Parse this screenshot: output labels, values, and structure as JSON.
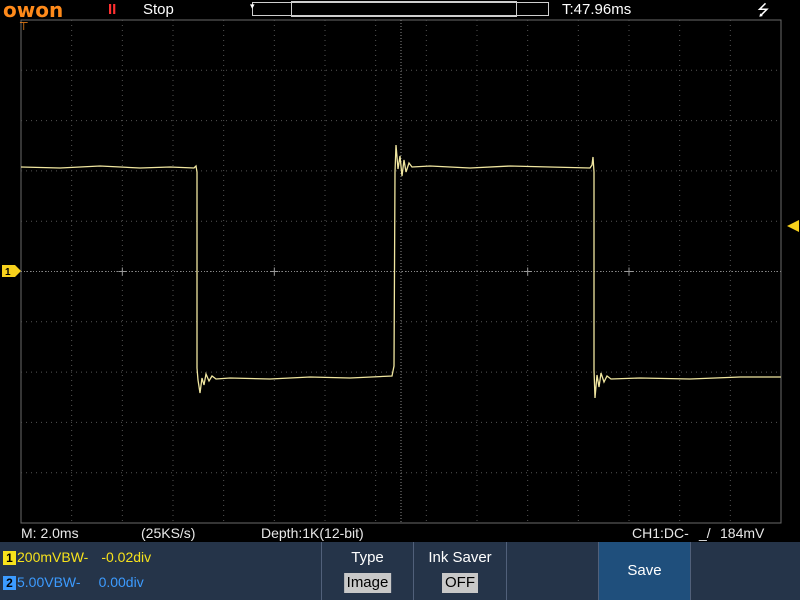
{
  "header": {
    "logo": "owon",
    "run_state_icon": "II",
    "run_state": "Stop",
    "trigger_time": "T:47.96ms",
    "usb_icon": "usb-icon"
  },
  "status": {
    "timebase": "M: 2.0ms",
    "sample_rate": "(25KS/s)",
    "depth": "Depth:1K(12-bit)",
    "trigger": "CH1:DC-",
    "trigger_edge_icon": "rising-edge-icon",
    "trigger_level": "184mV"
  },
  "channels": [
    {
      "number": "1",
      "scale": "200mV",
      "bw": "BW-",
      "offset": "-0.02div",
      "color": "#f7e21c"
    },
    {
      "number": "2",
      "scale": "5.00V",
      "bw": "BW-",
      "offset": "0.00div",
      "color": "#3c9bff"
    }
  ],
  "menu": [
    {
      "title": "Type",
      "value": "Image"
    },
    {
      "title": "Ink Saver",
      "value": "OFF"
    },
    {
      "title": "Save",
      "value": ""
    }
  ],
  "markers": {
    "ch1_label": "1"
  },
  "colors": {
    "trace": "#f0e6a0",
    "grid": "#4a4a4a",
    "logo": "#ff8a1a",
    "run_state": "#ff3030",
    "bottom_bar": "#253449",
    "marker": "#f7d11c"
  }
}
